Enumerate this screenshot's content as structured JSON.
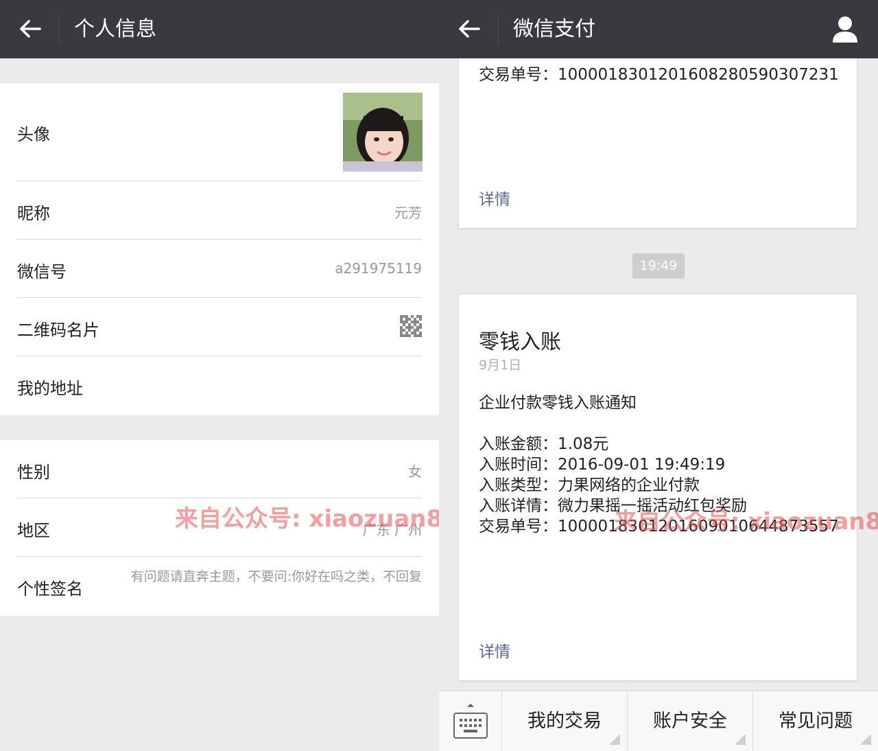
{
  "left": {
    "header": {
      "title": "个人信息"
    },
    "rows": {
      "avatar": {
        "label": "头像"
      },
      "nickname": {
        "label": "昵称",
        "value": "元芳"
      },
      "wechat_id": {
        "label": "微信号",
        "value": "a291975119"
      },
      "qr_card": {
        "label": "二维码名片"
      },
      "address": {
        "label": "我的地址"
      },
      "gender": {
        "label": "性别",
        "value": "女"
      },
      "region": {
        "label": "地区",
        "value": "广东 广州"
      },
      "signature": {
        "label": "个性签名",
        "value": "有问题请直奔主题，不要问:你好在吗之类，不回复"
      }
    },
    "watermark": "来自公众号: xiaozuan8"
  },
  "right": {
    "header": {
      "title": "微信支付"
    },
    "card1": {
      "txn": "交易单号：1000018301201608280590307231",
      "detail": "详情"
    },
    "time": "19:49",
    "card2": {
      "title": "零钱入账",
      "date": "9月1日",
      "notice": "企业付款零钱入账通知",
      "lines": [
        "入账金额：1.08元",
        "入账时间：2016-09-01 19:49:19",
        "入账类型：力果网络的企业付款",
        "入账详情：微力果摇一摇活动红包奖励",
        "交易单号：1000018301201609010644873557"
      ],
      "detail": "详情"
    },
    "watermark": "来自公众号: xiaozuan8",
    "menu": [
      "我的交易",
      "账户安全",
      "常见问题"
    ]
  },
  "colors": {
    "header": "#393a3f",
    "link": "#576b95",
    "watermark": "#e65050"
  },
  "icons": {
    "back": "arrow-left-icon",
    "person": "person-icon",
    "qr": "qr-code-icon",
    "keyboard": "keyboard-icon"
  }
}
